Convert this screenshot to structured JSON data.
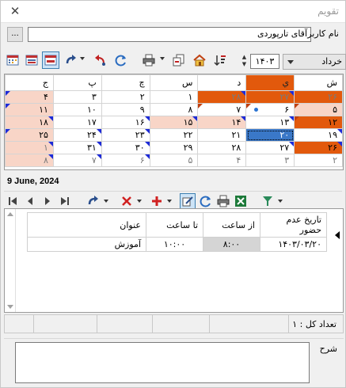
{
  "window": {
    "title": "تقویم",
    "close": "✕"
  },
  "user": {
    "label": "نام کاربر",
    "value": "آقای تارپوردی",
    "more": "..."
  },
  "toolbar": {
    "year": "۱۴۰۳",
    "month": "خرداد"
  },
  "calendar": {
    "days": [
      "ش",
      "ي",
      "د",
      "س",
      "چ",
      "پ",
      "ج"
    ],
    "rows": [
      [
        "۲۶",
        "۲۷",
        "۲۸",
        "۱",
        "۲",
        "۳",
        "۴"
      ],
      [
        "۵",
        "۶",
        "۷",
        "۸",
        "۹",
        "۱۰",
        "۱۱"
      ],
      [
        "۱۲",
        "۱۳",
        "۱۴",
        "۱۵",
        "۱۶",
        "۱۷",
        "۱۸"
      ],
      [
        "۱۹",
        "۲۰",
        "۲۱",
        "۲۲",
        "۲۳",
        "۲۴",
        "۲۵"
      ],
      [
        "۲۶",
        "۲۷",
        "۲۸",
        "۲۹",
        "۳۰",
        "۳۱",
        "۱"
      ],
      [
        "۲",
        "۳",
        "۴",
        "۵",
        "۶",
        "۷",
        "۸"
      ]
    ]
  },
  "selected_date": "9 June, 2024",
  "grid": {
    "headers": [
      "تاریخ عدم حضور",
      "از ساعت",
      "تا ساعت",
      "عنوان"
    ],
    "rows": [
      [
        "۱۴۰۳/۰۳/۲۰",
        "۸:۰۰",
        "۱۰:۰۰",
        "آموزش"
      ]
    ]
  },
  "status": {
    "total": "تعداد کل : ۱"
  },
  "description": {
    "label": "شرح"
  }
}
